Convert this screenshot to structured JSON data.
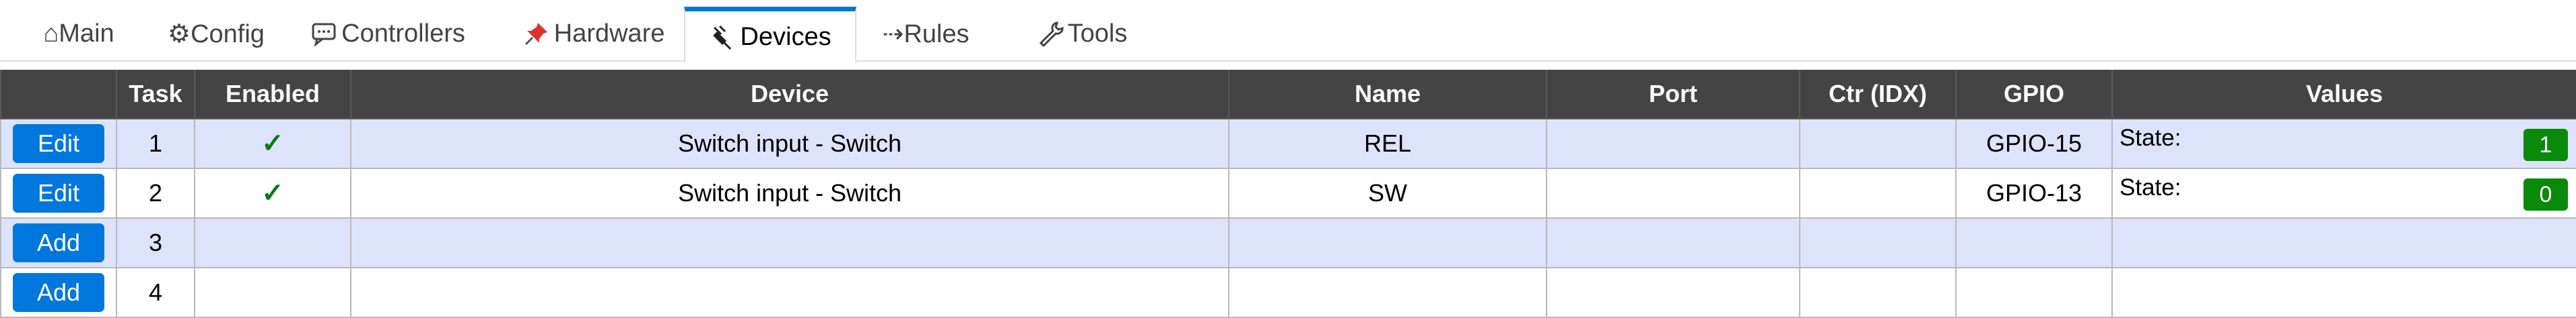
{
  "tabs": [
    {
      "id": "main",
      "icon": "home-icon",
      "label": "⌂Main"
    },
    {
      "id": "config",
      "icon": "gear-icon",
      "label": "⚙Config"
    },
    {
      "id": "controllers",
      "icon": "chat-icon",
      "label": "Controllers"
    },
    {
      "id": "hardware",
      "icon": "pushpin-icon",
      "label": "Hardware"
    },
    {
      "id": "devices",
      "icon": "plug-icon",
      "label": "Devices",
      "active": true
    },
    {
      "id": "rules",
      "icon": "arrow-icon",
      "label": "⇢Rules"
    },
    {
      "id": "tools",
      "icon": "wrench-icon",
      "label": "Tools"
    }
  ],
  "table": {
    "headers": [
      "",
      "Task",
      "Enabled",
      "Device",
      "Name",
      "Port",
      "Ctr (IDX)",
      "GPIO",
      "Values"
    ],
    "rows": [
      {
        "button": "Edit",
        "task": "1",
        "enabled": "✓",
        "device": "Switch input - Switch",
        "name": "REL",
        "port": "",
        "ctr": "",
        "gpio": "GPIO-15",
        "value_label": "State:",
        "value": "1"
      },
      {
        "button": "Edit",
        "task": "2",
        "enabled": "✓",
        "device": "Switch input - Switch",
        "name": "SW",
        "port": "",
        "ctr": "",
        "gpio": "GPIO-13",
        "value_label": "State:",
        "value": "0"
      },
      {
        "button": "Add",
        "task": "3",
        "enabled": "",
        "device": "",
        "name": "",
        "port": "",
        "ctr": "",
        "gpio": "",
        "value_label": "",
        "value": ""
      },
      {
        "button": "Add",
        "task": "4",
        "enabled": "",
        "device": "",
        "name": "",
        "port": "",
        "ctr": "",
        "gpio": "",
        "value_label": "",
        "value": ""
      }
    ]
  },
  "colors": {
    "accent": "#0077cc",
    "header_bg": "#444444",
    "row_alt_bg": "#dde3fb",
    "state_badge": "#0a8a0a",
    "check": "#0a7a16"
  }
}
